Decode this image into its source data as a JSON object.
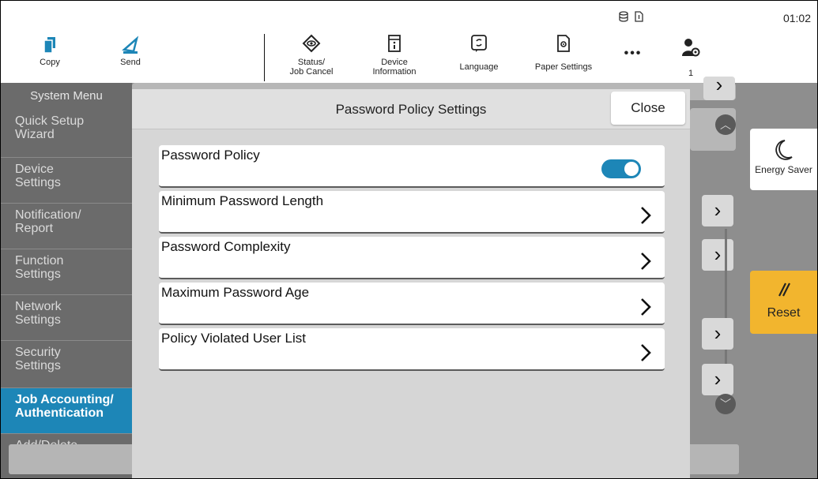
{
  "topbar": {
    "copy_label": "Copy",
    "send_label": "Send",
    "status_label_line1": "Status/",
    "status_label_line2": "Job Cancel",
    "device_info_line1": "Device",
    "device_info_line2": "Information",
    "language_label": "Language",
    "paper_settings_label": "Paper Settings",
    "more_label": "•••",
    "user_count": "1",
    "clock": "01:02"
  },
  "sidebar": {
    "title": "System Menu",
    "items": [
      {
        "line1": "Quick Setup",
        "line2": "Wizard"
      },
      {
        "line1": "Device",
        "line2": "Settings"
      },
      {
        "line1": "Notification/",
        "line2": "Report"
      },
      {
        "line1": "Function",
        "line2": "Settings"
      },
      {
        "line1": "Network",
        "line2": "Settings"
      },
      {
        "line1": "Security",
        "line2": "Settings"
      },
      {
        "line1": "Job Accounting/",
        "line2": "Authentication"
      },
      {
        "line1": "Add/Delete",
        "line2": ""
      }
    ]
  },
  "side_buttons": {
    "energy_saver": "Energy Saver",
    "reset": "Reset"
  },
  "dialog": {
    "title": "Password Policy Settings",
    "close_label": "Close",
    "rows": [
      {
        "label": "Password Policy",
        "type": "toggle",
        "on": true
      },
      {
        "label": "Minimum Password Length",
        "type": "link"
      },
      {
        "label": "Password Complexity",
        "type": "link"
      },
      {
        "label": "Maximum Password Age",
        "type": "link"
      },
      {
        "label": "Policy Violated User List",
        "type": "link"
      }
    ]
  },
  "colors": {
    "accent": "#1d86b7",
    "reset": "#f2b52e",
    "overlay": "#8e8e8e"
  }
}
